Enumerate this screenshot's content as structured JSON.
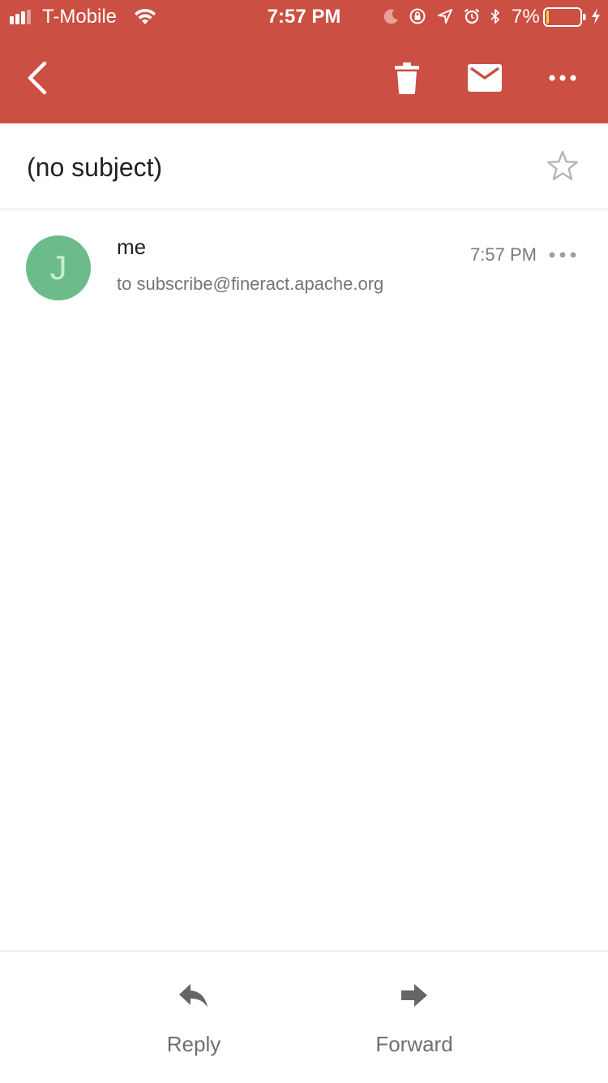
{
  "status_bar": {
    "carrier": "T-Mobile",
    "time": "7:57 PM",
    "battery_percent": "7%",
    "battery_level": 0.07,
    "icons": [
      "signal-icon",
      "wifi-icon",
      "moon-icon",
      "rotation-lock-icon",
      "location-icon",
      "alarm-icon",
      "bluetooth-icon",
      "battery-icon",
      "charging-icon"
    ]
  },
  "app_bar": {
    "background_color": "#cb4f42",
    "icons": [
      "back-arrow-icon",
      "trash-icon",
      "mail-icon",
      "more-horizontal-icon"
    ]
  },
  "email": {
    "subject": "(no subject)",
    "starred": false,
    "sender": {
      "name": "me",
      "avatar_initial": "J",
      "avatar_color": "#6cbc8b"
    },
    "recipient_line": "to subscribe@fineract.apache.org",
    "time": "7:57 PM"
  },
  "actions": {
    "reply_label": "Reply",
    "forward_label": "Forward"
  }
}
